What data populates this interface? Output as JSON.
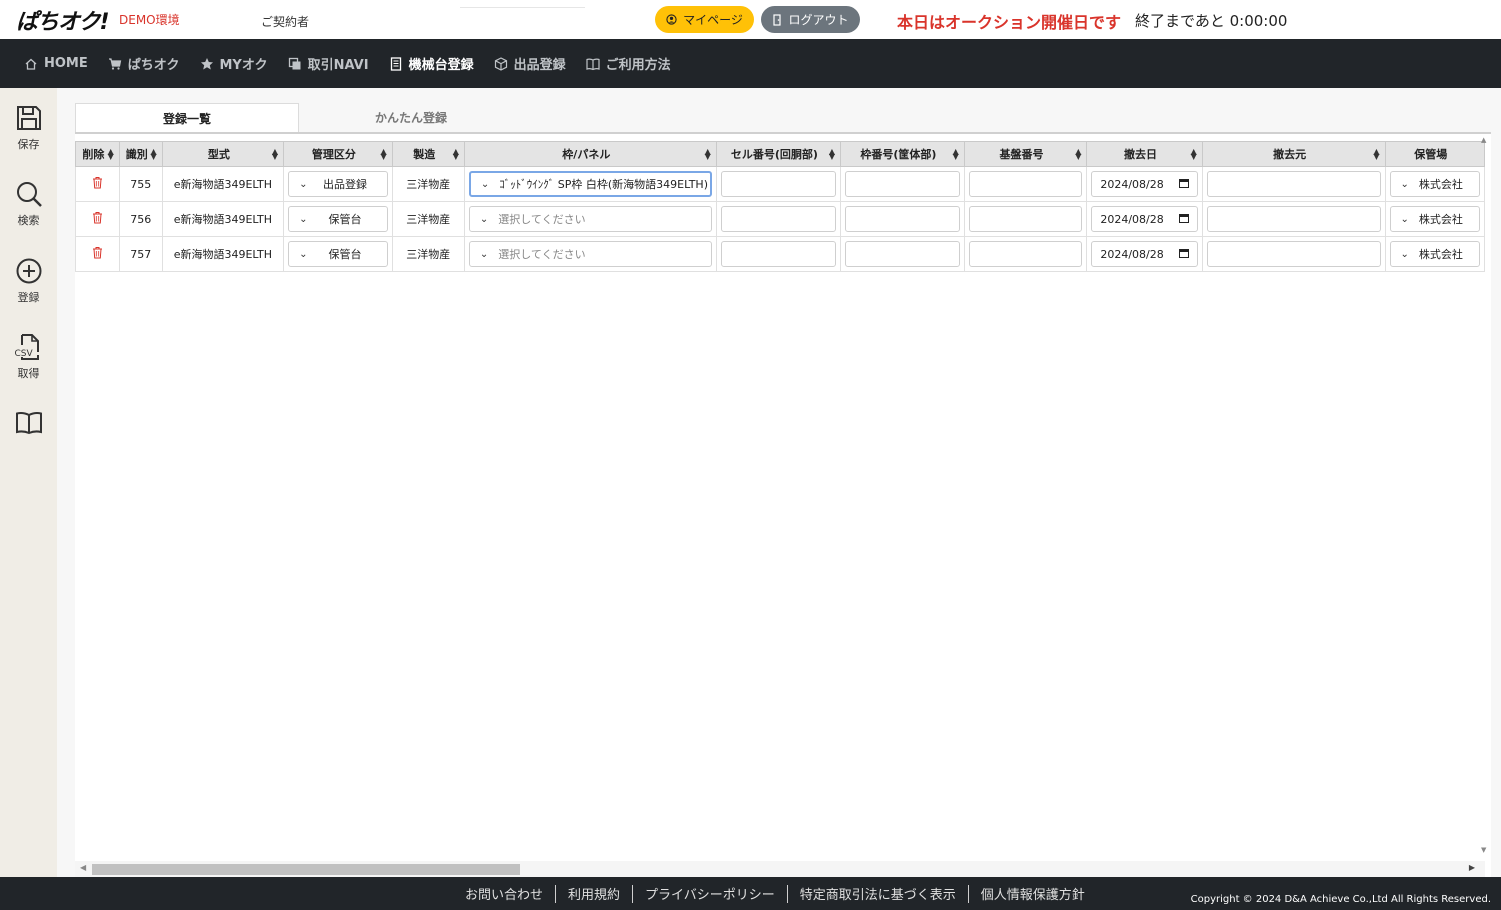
{
  "header": {
    "logo": "ぱちオク!",
    "demo": "DEMO環境",
    "contract": "ご契約者",
    "mypage": "マイページ",
    "logout": "ログアウト",
    "auction_msg": "本日はオークション開催日です",
    "countdown": "終了まであと 0:00:00",
    "colors": {
      "accent_red": "#d9342b",
      "mypage_yellow": "#ffc107",
      "logout_gray": "#6c757d",
      "nav_dark": "#212529"
    }
  },
  "nav": [
    {
      "label": "HOME",
      "icon": "home-icon"
    },
    {
      "label": "ぱちオク",
      "icon": "cart-icon"
    },
    {
      "label": "MYオク",
      "icon": "star-icon"
    },
    {
      "label": "取引NAVI",
      "icon": "copy-icon"
    },
    {
      "label": "機械台登録",
      "icon": "document-icon",
      "active": true
    },
    {
      "label": "出品登録",
      "icon": "box-icon"
    },
    {
      "label": "ご利用方法",
      "icon": "book-icon"
    }
  ],
  "sidebar": {
    "save": "保存",
    "search": "検索",
    "register": "登録",
    "csv_tag": "CSV",
    "fetch": "取得"
  },
  "tabs": {
    "list": "登録一覧",
    "easy": "かんたん登録"
  },
  "table": {
    "headers": [
      "削除",
      "識別",
      "型式",
      "管理区分",
      "製造",
      "枠/パネル",
      "セル番号(回胴部)",
      "枠番号(筐体部)",
      "基盤番号",
      "撤去日",
      "撤去元",
      "保管場"
    ],
    "rows": [
      {
        "id": "755",
        "model": "e新海物語349ELTH",
        "category": "出品登録",
        "maker": "三洋物産",
        "panel": "ｺﾞｯﾄﾞｳｲﾝｸﾞ SP枠 白枠(新海物語349ELTH)",
        "panel_placeholder": false,
        "date": "2024/08/28",
        "storage": "株式会社"
      },
      {
        "id": "756",
        "model": "e新海物語349ELTH",
        "category": "保管台",
        "maker": "三洋物産",
        "panel": "選択してください",
        "panel_placeholder": true,
        "date": "2024/08/28",
        "storage": "株式会社"
      },
      {
        "id": "757",
        "model": "e新海物語349ELTH",
        "category": "保管台",
        "maker": "三洋物産",
        "panel": "選択してください",
        "panel_placeholder": true,
        "date": "2024/08/28",
        "storage": "株式会社"
      }
    ]
  },
  "footer": {
    "links": [
      "お問い合わせ",
      "利用規約",
      "プライバシーポリシー",
      "特定商取引法に基づく表示",
      "個人情報保護方針"
    ],
    "copyright": "Copyright © 2024 D&A Achieve Co.,Ltd All Rights Reserved."
  }
}
